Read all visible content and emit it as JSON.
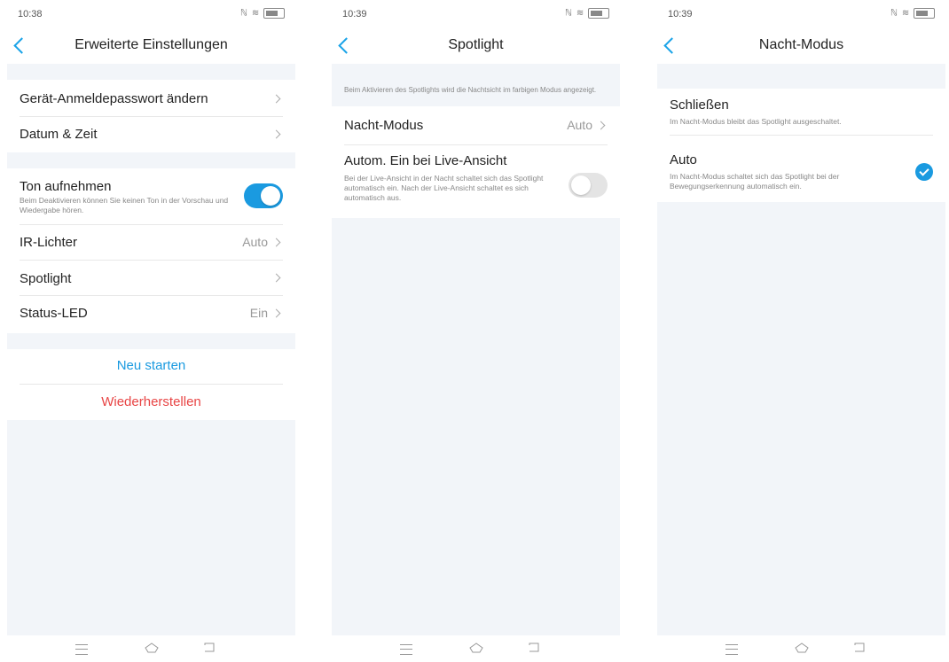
{
  "screen1": {
    "time": "10:38",
    "status_icons": "ℕ ≋",
    "title": "Erweiterte Einstellungen",
    "rows": {
      "password": "Gerät-Anmeldepasswort ändern",
      "datetime": "Datum & Zeit",
      "sound": "Ton aufnehmen",
      "sound_desc": "Beim Deaktivieren können Sie keinen Ton in der Vorschau und Wiedergabe hören.",
      "ir": "IR-Lichter",
      "ir_value": "Auto",
      "spotlight": "Spotlight",
      "led": "Status-LED",
      "led_value": "Ein"
    },
    "sound_enabled": true,
    "restart": "Neu starten",
    "restore": "Wiederherstellen"
  },
  "screen2": {
    "time": "10:39",
    "status_icons": "ℕ ≋",
    "title": "Spotlight",
    "info": "Beim Aktivieren des Spotlights wird die Nachtsicht im farbigen Modus angezeigt.",
    "night_mode": "Nacht-Modus",
    "night_mode_value": "Auto",
    "autom": "Autom. Ein bei Live-Ansicht",
    "autom_desc": "Bei der Live-Ansicht in der Nacht schaltet sich das Spotlight automatisch ein. Nach der Live-Ansicht schaltet es sich automatisch aus.",
    "autom_enabled": false
  },
  "screen3": {
    "time": "10:39",
    "status_icons": "ℕ ≋",
    "title": "Nacht-Modus",
    "options": [
      {
        "label": "Schließen",
        "desc": "Im Nacht-Modus bleibt das Spotlight ausgeschaltet.",
        "selected": false
      },
      {
        "label": "Auto",
        "desc": "Im Nacht-Modus schaltet sich das Spotlight bei der Bewegungserkennung automatisch ein.",
        "selected": true
      }
    ]
  },
  "colors": {
    "accent": "#1a9ae0",
    "danger": "#e84545",
    "background": "#f2f5f9"
  },
  "icons": [
    "back-icon",
    "chevron-right-icon",
    "toggle",
    "check-icon",
    "menu-icon",
    "home-icon",
    "back-nav-icon",
    "wifi-icon",
    "battery-icon"
  ]
}
